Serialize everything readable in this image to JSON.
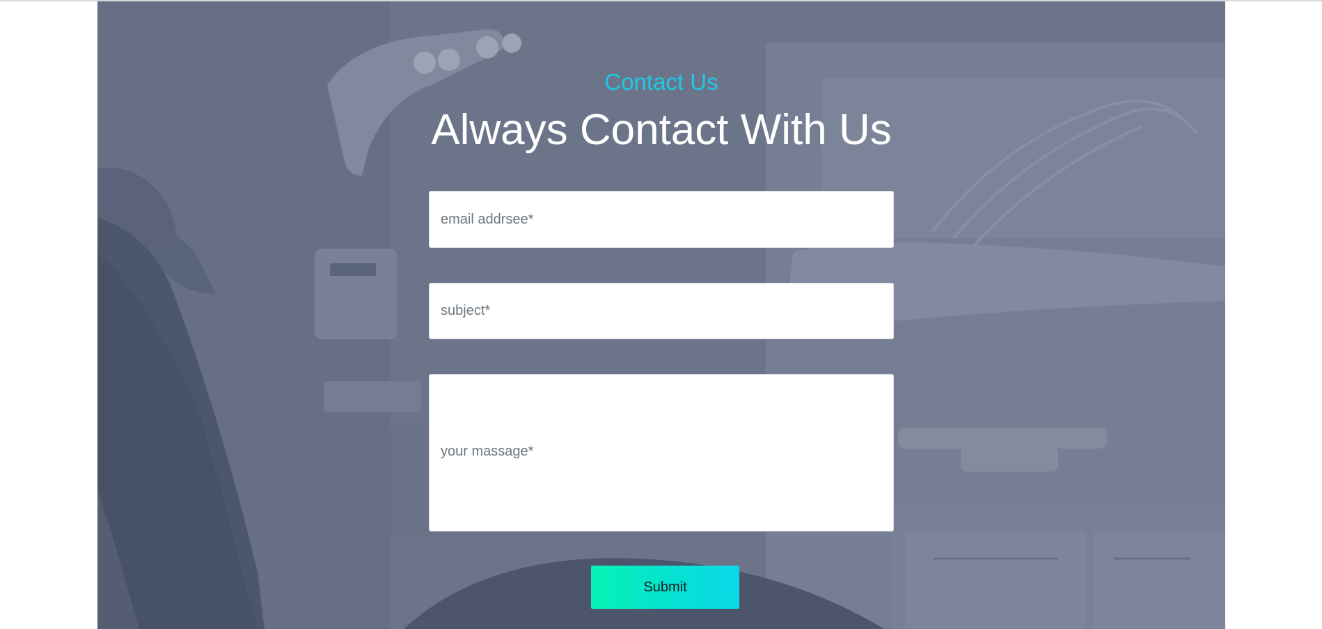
{
  "section": {
    "eyebrow": "Contact Us",
    "heading": "Always Contact With Us"
  },
  "form": {
    "email_placeholder": "email addrsee*",
    "subject_placeholder": "subject*",
    "message_placeholder": "your massage*",
    "submit_label": "Submit"
  },
  "colors": {
    "accent": "#1ec9e6",
    "button_gradient_start": "#05f3b5",
    "button_gradient_end": "#0ad7e8",
    "overlay": "#6b7488"
  },
  "background": {
    "icon": "dental-clinic-photo"
  }
}
